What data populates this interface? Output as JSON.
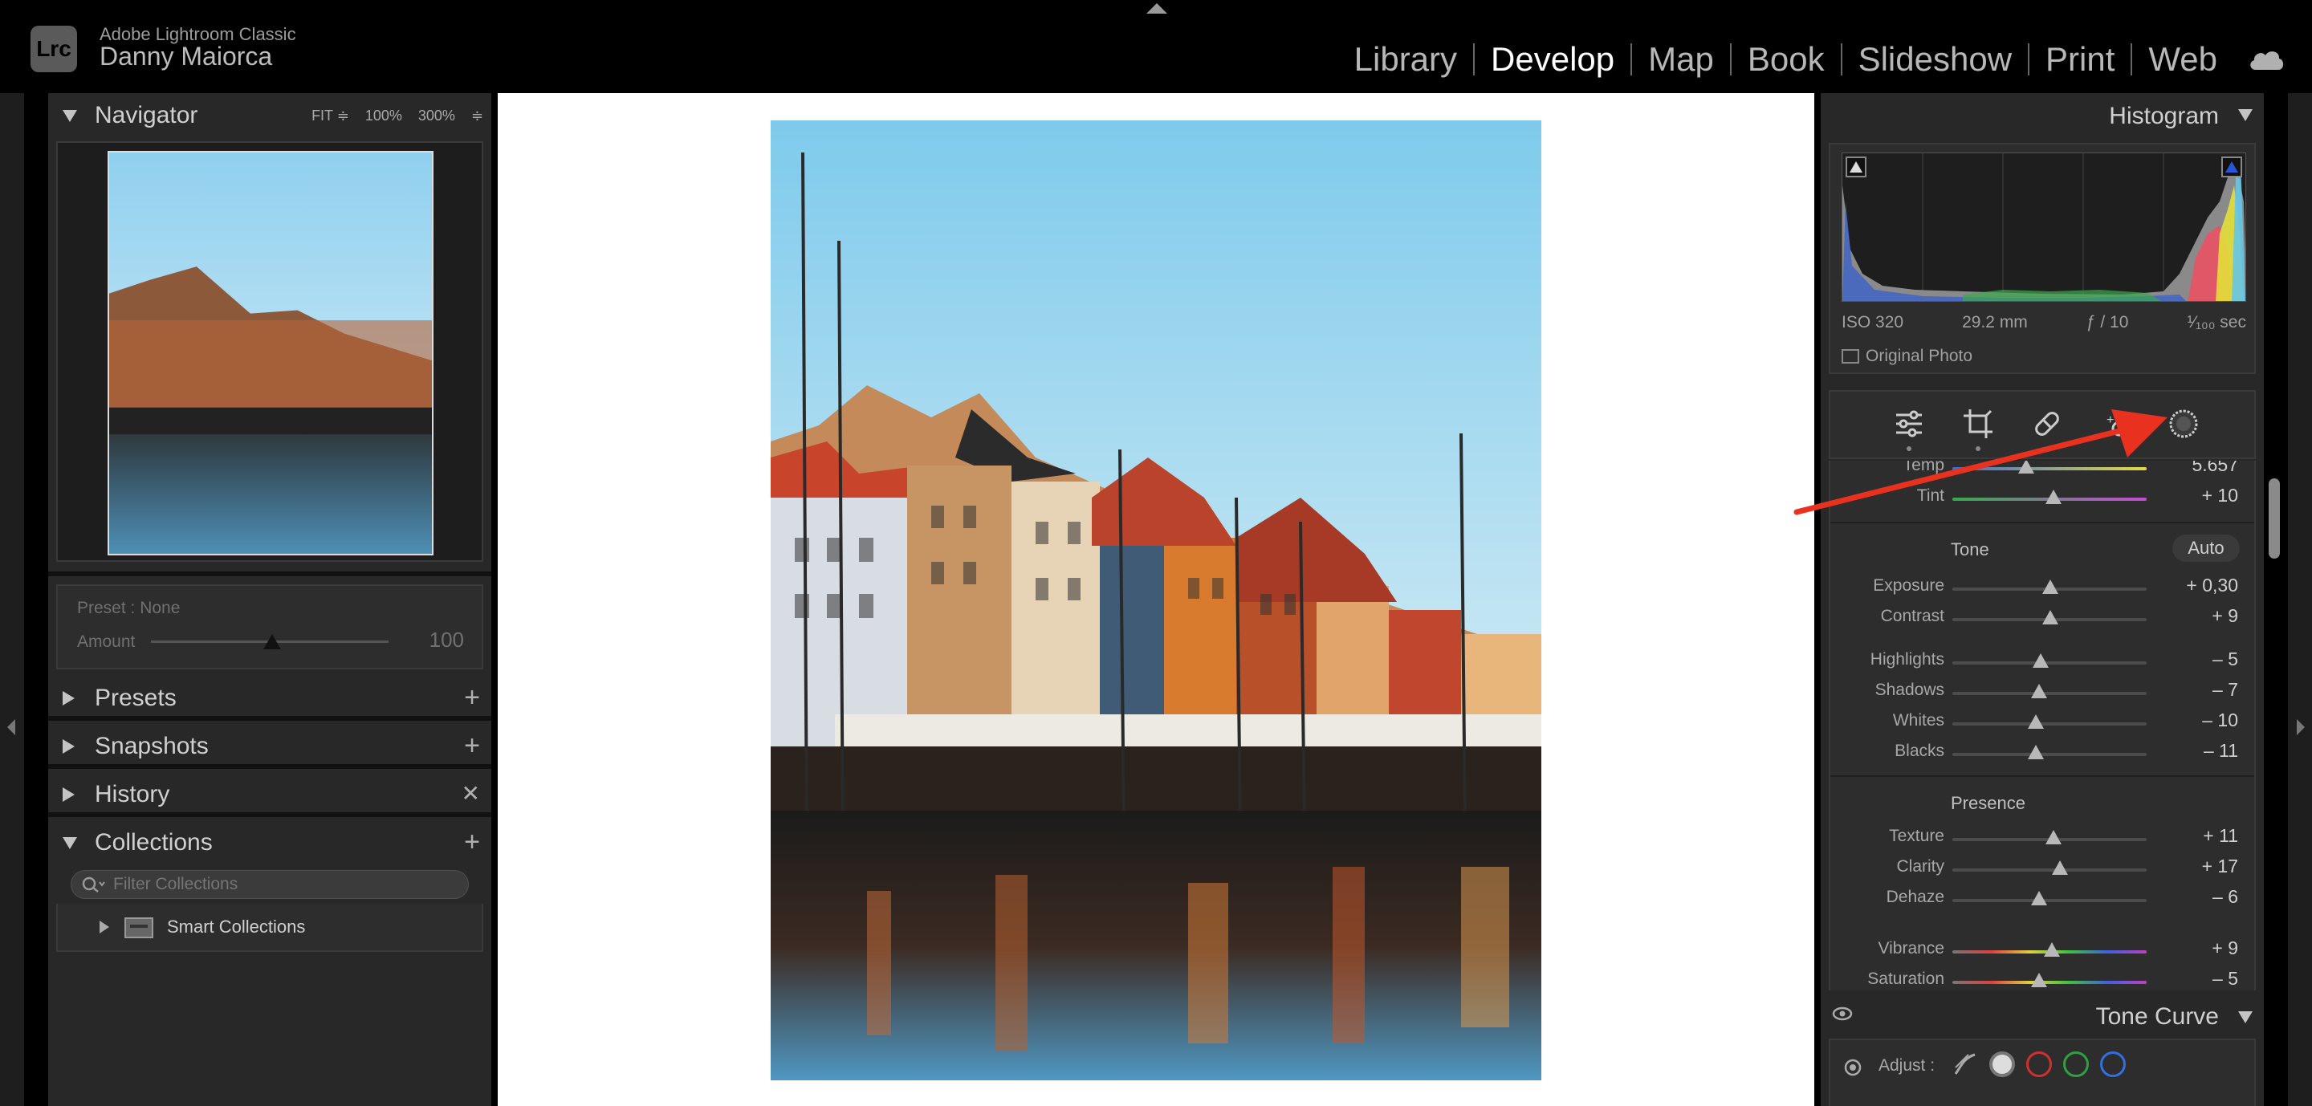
{
  "topbar": {
    "logo_text": "Lrc",
    "app_name": "Adobe Lightroom Classic",
    "user_name": "Danny Maiorca",
    "modules": [
      "Library",
      "Develop",
      "Map",
      "Book",
      "Slideshow",
      "Print",
      "Web"
    ],
    "active_module": "Develop"
  },
  "left_panel": {
    "navigator": {
      "title": "Navigator",
      "zoom_fit": "FIT ≑",
      "zoom_100": "100%",
      "zoom_300": "300%"
    },
    "preset": {
      "label": "Preset : None",
      "amount_label": "Amount",
      "amount_value": "100",
      "amount_fraction": 0.55
    },
    "panels": {
      "presets": "Presets",
      "snapshots": "Snapshots",
      "history": "History",
      "collections": "Collections"
    },
    "collections": {
      "filter_placeholder": "Filter Collections",
      "smart_collections": "Smart Collections"
    }
  },
  "right_panel": {
    "histogram": {
      "title": "Histogram",
      "iso": "ISO 320",
      "focal_length": "29.2 mm",
      "aperture": "ƒ / 10",
      "shutter": "¹⁄₁₀₀ sec",
      "original_photo": "Original Photo"
    },
    "tools": [
      "sliders-icon",
      "crop-icon",
      "healing-icon",
      "red-eye-icon",
      "masking-icon"
    ],
    "basic": {
      "temp": {
        "label": "Temp",
        "value": "5.657"
      },
      "tint": {
        "label": "Tint",
        "value": "+ 10"
      },
      "tone_title": "Tone",
      "auto_label": "Auto",
      "exposure": {
        "label": "Exposure",
        "value": "+ 0,30"
      },
      "contrast": {
        "label": "Contrast",
        "value": "+ 9"
      },
      "highlights": {
        "label": "Highlights",
        "value": "– 5"
      },
      "shadows": {
        "label": "Shadows",
        "value": "– 7"
      },
      "whites": {
        "label": "Whites",
        "value": "– 10"
      },
      "blacks": {
        "label": "Blacks",
        "value": "– 11"
      },
      "presence_title": "Presence",
      "texture": {
        "label": "Texture",
        "value": "+ 11"
      },
      "clarity": {
        "label": "Clarity",
        "value": "+ 17"
      },
      "dehaze": {
        "label": "Dehaze",
        "value": "– 6"
      },
      "vibrance": {
        "label": "Vibrance",
        "value": "+ 9"
      },
      "saturation": {
        "label": "Saturation",
        "value": "– 5"
      }
    },
    "tone_curve": {
      "title": "Tone Curve",
      "adjust_label": "Adjust :"
    }
  },
  "colors": {
    "accent_arrow": "#e8321f",
    "panel_bg": "#282828",
    "subpanel_bg": "#2d2d2d"
  }
}
